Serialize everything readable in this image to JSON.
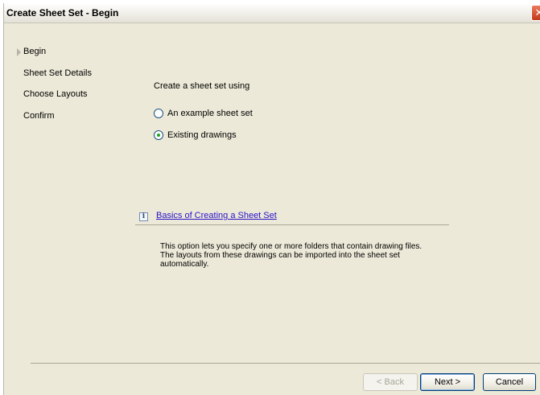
{
  "window": {
    "title": "Create Sheet Set - Begin",
    "close_glyph": "✕"
  },
  "nav": {
    "items": [
      {
        "label": "Begin",
        "current": true
      },
      {
        "label": "Sheet Set Details"
      },
      {
        "label": "Choose Layouts"
      },
      {
        "label": "Confirm"
      }
    ]
  },
  "main": {
    "prompt": "Create a sheet set using",
    "options": [
      {
        "label": "An example sheet set",
        "checked": false
      },
      {
        "label": "Existing drawings",
        "checked": true
      }
    ],
    "info_icon_glyph": "i",
    "help_link": "Basics of Creating a Sheet Set",
    "description": "This option lets you specify one or more folders that contain drawing files.  The layouts from these drawings can be imported into the sheet set automatically."
  },
  "buttons": {
    "back": "< Back",
    "next": "Next >",
    "cancel": "Cancel"
  },
  "colors": {
    "dialog_bg": "#ece9d8",
    "link": "#2a13c7",
    "radio_dot": "#21a121",
    "close_button": "#c4381a"
  }
}
